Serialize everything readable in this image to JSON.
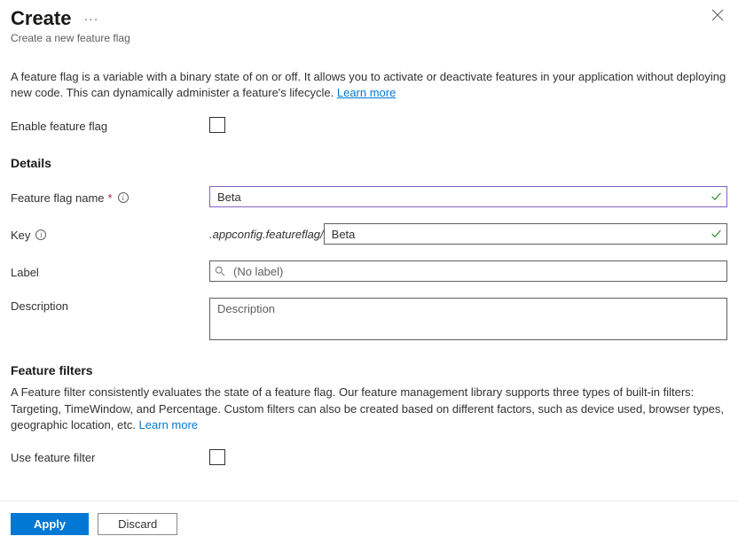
{
  "header": {
    "title": "Create",
    "subtitle": "Create a new feature flag"
  },
  "intro": {
    "text": "A feature flag is a variable with a binary state of on or off. It allows you to activate or deactivate features in your application without deploying new code. This can dynamically administer a feature's lifecycle. ",
    "learn_more": "Learn more"
  },
  "enable": {
    "label": "Enable feature flag"
  },
  "details": {
    "heading": "Details",
    "name_label": "Feature flag name",
    "name_value": "Beta",
    "key_label": "Key",
    "key_prefix": ".appconfig.featureflag/",
    "key_value": "Beta",
    "label_label": "Label",
    "label_placeholder": "(No label)",
    "description_label": "Description",
    "description_placeholder": "Description"
  },
  "filters": {
    "heading": "Feature filters",
    "text": "A Feature filter consistently evaluates the state of a feature flag. Our feature management library supports three types of built-in filters: Targeting, TimeWindow, and Percentage. Custom filters can also be created based on different factors, such as device used, browser types, geographic location, etc. ",
    "learn_more": "Learn more",
    "use_label": "Use feature filter"
  },
  "footer": {
    "apply": "Apply",
    "discard": "Discard"
  }
}
